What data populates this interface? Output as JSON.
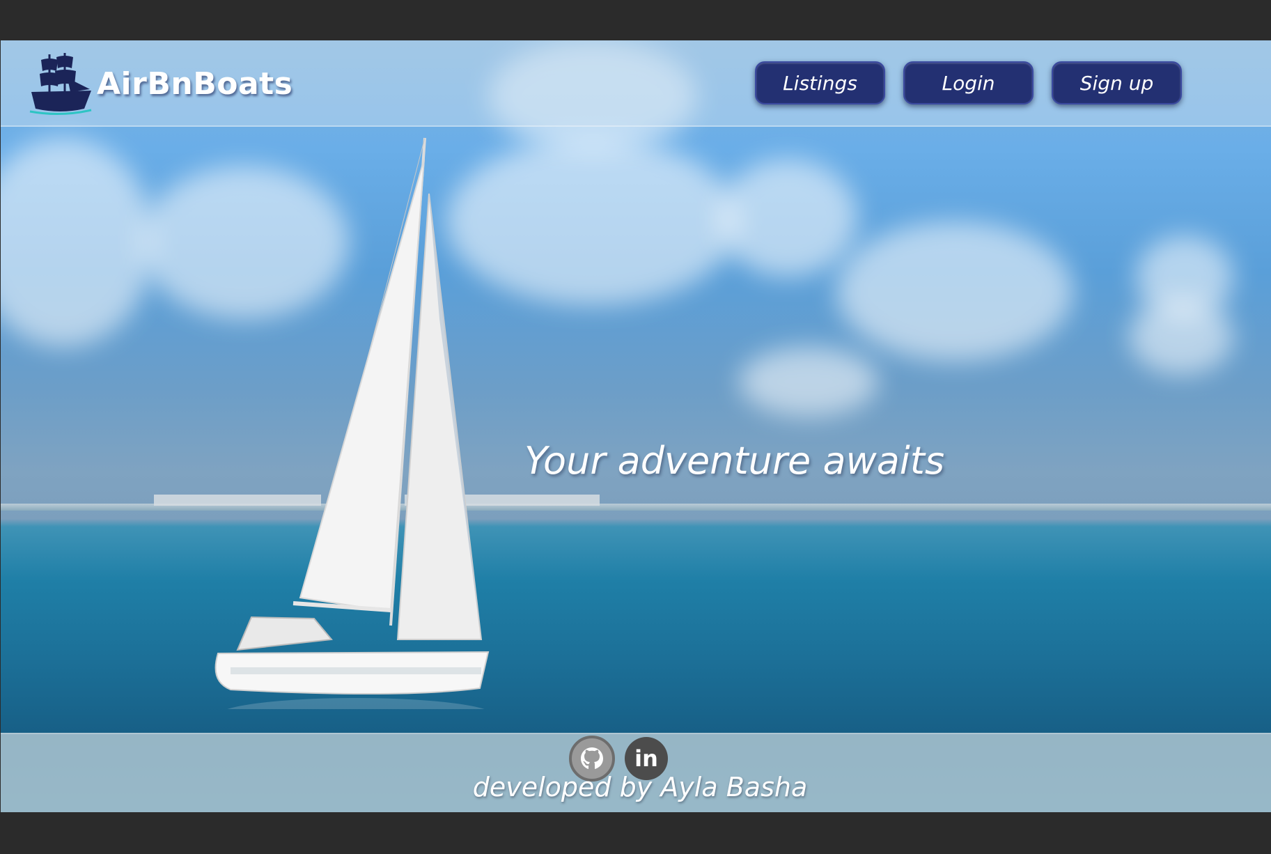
{
  "brand": {
    "name": "AirBnBoats",
    "logo_icon": "ship-icon"
  },
  "nav": {
    "listings_label": "Listings",
    "login_label": "Login",
    "signup_label": "Sign up"
  },
  "hero": {
    "tagline": "Your adventure awaits"
  },
  "footer": {
    "github_icon": "github-icon",
    "linkedin_icon": "linkedin-icon",
    "linkedin_glyph": "in",
    "credit": "developed by Ayla Basha"
  },
  "colors": {
    "button_bg": "#233072",
    "page_bg": "#2b2b2b",
    "text": "#ffffff"
  }
}
